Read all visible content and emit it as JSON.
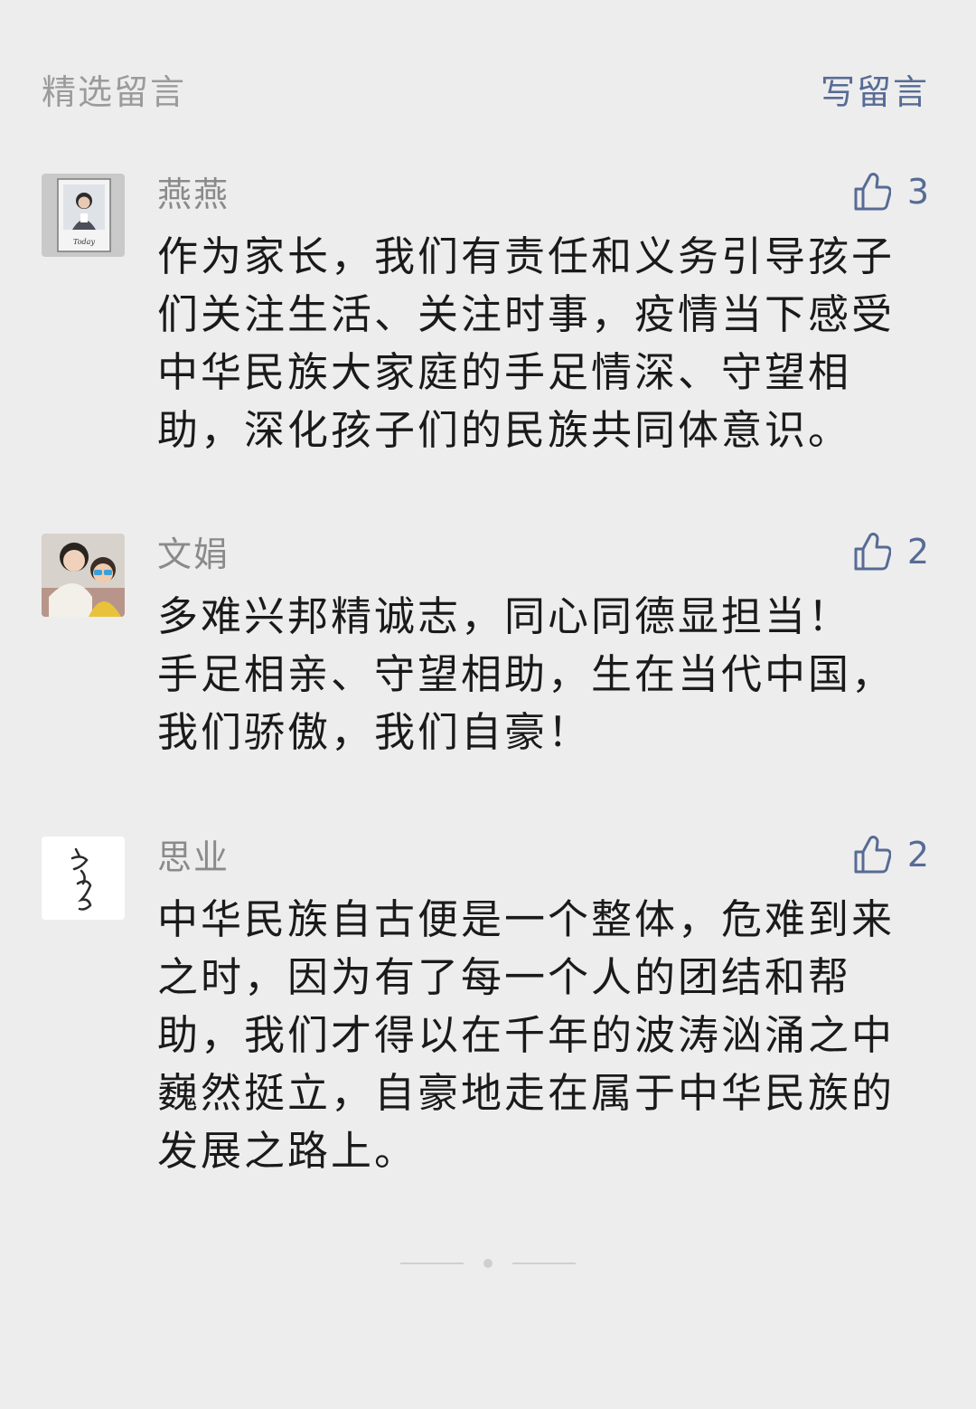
{
  "header": {
    "title": "精选留言",
    "write_label": "写留言"
  },
  "comments": [
    {
      "nickname": "燕燕",
      "likes": "3",
      "avatar_text": "Today",
      "text": "作为家长，我们有责任和义务引导孩子\n们关注生活、关注时事，疫情当下感受\n中华民族大家庭的手足情深、守望相\n助，深化孩子们的民族共同体意识。"
    },
    {
      "nickname": "文娟",
      "likes": "2",
      "text": "多难兴邦精诚志，同心同德显担当！\n手足相亲、守望相助，生在当代中国，\n我们骄傲，我们自豪！"
    },
    {
      "nickname": "思业",
      "likes": "2",
      "text": "中华民族自古便是一个整体，危难到来\n之时，因为有了每一个人的团结和帮\n助，我们才得以在千年的波涛汹涌之中\n巍然挺立，自豪地走在属于中华民族的\n发展之路上。"
    }
  ],
  "pager": {
    "active_index": 1
  },
  "colors": {
    "background": "#ededed",
    "link": "#576b95",
    "muted": "#9b9b9b",
    "text": "#1a1a1a"
  },
  "icons": {
    "like": "thumbs-up-icon"
  }
}
